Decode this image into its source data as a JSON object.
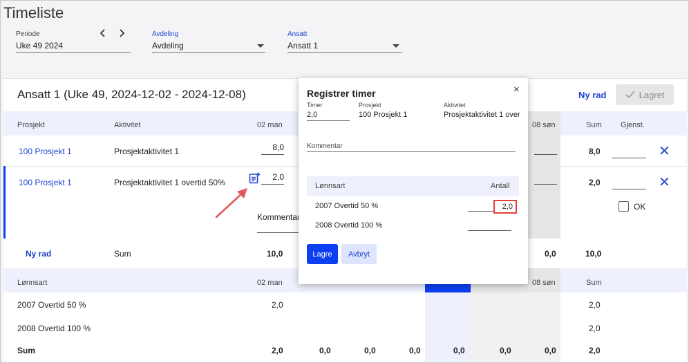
{
  "app": {
    "title": "Timeliste"
  },
  "filters": {
    "periode": {
      "label": "Periode",
      "value": "Uke 49 2024"
    },
    "avdeling": {
      "label": "Avdeling",
      "value": "Avdeling"
    },
    "ansatt": {
      "label": "Ansatt",
      "value": "Ansatt 1"
    }
  },
  "sheet": {
    "title": "Ansatt 1 (Uke 49, 2024-12-02 - 2024-12-08)",
    "ny_rad_top": "Ny rad",
    "lagret": "Lagret",
    "columns": {
      "prosjekt": "Prosjekt",
      "aktivitet": "Aktivitet",
      "d02": "02 man",
      "d08": "08 søn",
      "sum": "Sum",
      "gjenst": "Gjenst."
    },
    "rows": [
      {
        "prosjekt": "100 Prosjekt 1",
        "aktivitet": "Prosjektaktivitet 1",
        "d02": "8,0",
        "sum": "8,0"
      },
      {
        "prosjekt": "100 Prosjekt 1",
        "aktivitet": "Prosjektaktivitet 1 overtid 50%",
        "d02": "2,0",
        "sum": "2,0",
        "kommentar": "Kommentar",
        "ok": "OK"
      }
    ],
    "total": {
      "ny_rad": "Ny rad",
      "label": "Sum",
      "d02": "10,0",
      "d08": "0,0",
      "sum": "10,0"
    },
    "lonnsart_header": {
      "label": "Lønnsart",
      "d02": "02 man",
      "d08": "08 søn",
      "sum": "Sum"
    },
    "lonnsart_rows": [
      {
        "label": "2007 Overtid 50 %",
        "d02": "2,0",
        "sum": "2,0"
      },
      {
        "label": "2008 Overtid 100 %",
        "sum": "2,0"
      }
    ],
    "lonnsart_sum": {
      "label": "Sum",
      "values": [
        "2,0",
        "0,0",
        "0,0",
        "0,0",
        "0,0",
        "0,0",
        "0,0",
        "2,0"
      ]
    }
  },
  "modal": {
    "title": "Registrer timer",
    "close": "×",
    "timer_label": "Timer",
    "timer_value": "2,0",
    "prosjekt_label": "Prosjekt",
    "prosjekt_value": "100 Prosjekt 1",
    "aktivitet_label": "Aktivitet",
    "aktivitet_value": "Prosjektaktivitet 1 over",
    "kommentar_label": "Kommentar",
    "table": {
      "col_lonnsart": "Lønnsart",
      "col_antall": "Antall",
      "rows": [
        {
          "label": "2007 Overtid 50 %",
          "value": "2,0"
        },
        {
          "label": "2008 Overtid 100 %",
          "value": ""
        }
      ]
    },
    "lagre": "Lagre",
    "avbryt": "Avbryt"
  },
  "colors": {
    "accent": "#1f45d0",
    "primary_button": "#0b3ff0",
    "highlight": "#e0403a",
    "arrow": "#e05a5a"
  },
  "icons": [
    "chevron-left-icon",
    "chevron-right-icon",
    "chevron-down-icon",
    "close-icon",
    "check-icon",
    "add-note-icon",
    "arrow-icon"
  ]
}
